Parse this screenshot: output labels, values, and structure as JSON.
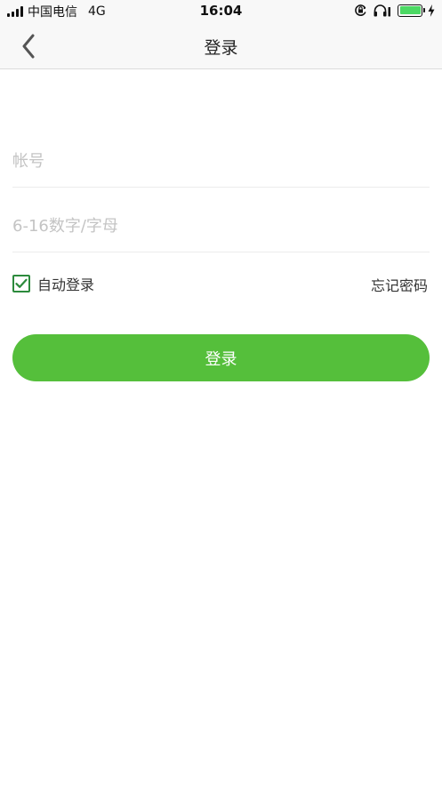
{
  "status_bar": {
    "carrier": "中国电信",
    "network": "4G",
    "time": "16:04",
    "battery_level": 1.0,
    "icons": [
      "signal-icon",
      "orientation-lock-icon",
      "headphones-icon",
      "battery-icon",
      "charging-icon"
    ]
  },
  "nav": {
    "title": "登录",
    "back_icon": "chevron-left-icon"
  },
  "form": {
    "account": {
      "value": "",
      "placeholder": "帐号"
    },
    "password": {
      "value": "",
      "placeholder": "6-16数字/字母"
    },
    "auto_login": {
      "label": "自动登录",
      "checked": true
    },
    "forgot_password": "忘记密码",
    "submit_label": "登录"
  },
  "colors": {
    "accent": "#55bf3b",
    "checkbox": "#2c8a3c",
    "placeholder": "#c4c4c4",
    "battery": "#4cd964"
  }
}
